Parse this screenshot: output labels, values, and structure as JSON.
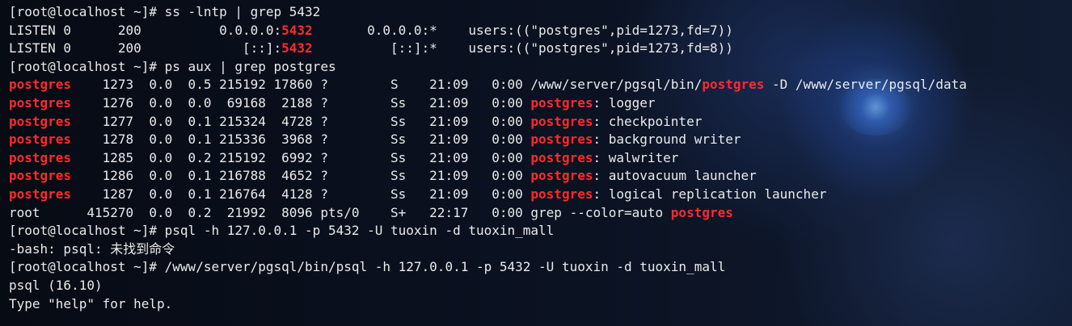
{
  "colors": {
    "terminal_text": "#eaeaea",
    "highlight_red": "#ff2a2a",
    "background": "#0b1220"
  },
  "terminal": {
    "lines": [
      [
        {
          "text": "[root@localhost ~]# ss -lntp | grep 5432",
          "red": false
        }
      ],
      [
        {
          "text": "LISTEN 0      200          0.0.0.0:",
          "red": false
        },
        {
          "text": "5432",
          "red": true
        },
        {
          "text": "       0.0.0.0:*    users:((\"postgres\",pid=1273,fd=7))",
          "red": false
        }
      ],
      [
        {
          "text": "LISTEN 0      200             [::]:",
          "red": false
        },
        {
          "text": "5432",
          "red": true
        },
        {
          "text": "          [::]:*    users:((\"postgres\",pid=1273,fd=8))",
          "red": false
        }
      ],
      [
        {
          "text": "[root@localhost ~]# ps aux | grep postgres",
          "red": false
        }
      ],
      [
        {
          "text": "postgres",
          "red": true
        },
        {
          "text": "    1273  0.0  0.5 215192 17860 ?        S    21:09   0:00 /www/server/pgsql/bin/",
          "red": false
        },
        {
          "text": "postgres",
          "red": true
        },
        {
          "text": " -D /www/server/pgsql/data",
          "red": false
        }
      ],
      [
        {
          "text": "postgres",
          "red": true
        },
        {
          "text": "    1276  0.0  0.0  69168  2188 ?        Ss   21:09   0:00 ",
          "red": false
        },
        {
          "text": "postgres",
          "red": true
        },
        {
          "text": ": logger",
          "red": false
        }
      ],
      [
        {
          "text": "postgres",
          "red": true
        },
        {
          "text": "    1277  0.0  0.1 215324  4728 ?        Ss   21:09   0:00 ",
          "red": false
        },
        {
          "text": "postgres",
          "red": true
        },
        {
          "text": ": checkpointer",
          "red": false
        }
      ],
      [
        {
          "text": "postgres",
          "red": true
        },
        {
          "text": "    1278  0.0  0.1 215336  3968 ?        Ss   21:09   0:00 ",
          "red": false
        },
        {
          "text": "postgres",
          "red": true
        },
        {
          "text": ": background writer",
          "red": false
        }
      ],
      [
        {
          "text": "postgres",
          "red": true
        },
        {
          "text": "    1285  0.0  0.2 215192  6992 ?        Ss   21:09   0:00 ",
          "red": false
        },
        {
          "text": "postgres",
          "red": true
        },
        {
          "text": ": walwriter",
          "red": false
        }
      ],
      [
        {
          "text": "postgres",
          "red": true
        },
        {
          "text": "    1286  0.0  0.1 216788  4652 ?        Ss   21:09   0:00 ",
          "red": false
        },
        {
          "text": "postgres",
          "red": true
        },
        {
          "text": ": autovacuum launcher",
          "red": false
        }
      ],
      [
        {
          "text": "postgres",
          "red": true
        },
        {
          "text": "    1287  0.0  0.1 216764  4128 ?        Ss   21:09   0:00 ",
          "red": false
        },
        {
          "text": "postgres",
          "red": true
        },
        {
          "text": ": logical replication launcher",
          "red": false
        }
      ],
      [
        {
          "text": "root      415270  0.0  0.2  21992  8096 pts/0    S+   22:17   0:00 grep --color=auto ",
          "red": false
        },
        {
          "text": "postgres",
          "red": true
        }
      ],
      [
        {
          "text": "[root@localhost ~]# psql -h 127.0.0.1 -p 5432 -U tuoxin -d tuoxin_mall",
          "red": false
        }
      ],
      [
        {
          "text": "-bash: psql: 未找到命令",
          "red": false
        }
      ],
      [
        {
          "text": "[root@localhost ~]# /www/server/pgsql/bin/psql -h 127.0.0.1 -p 5432 -U tuoxin -d tuoxin_mall",
          "red": false
        }
      ],
      [
        {
          "text": "psql (16.10)",
          "red": false
        }
      ],
      [
        {
          "text": "Type \"help\" for help.",
          "red": false
        }
      ]
    ]
  }
}
